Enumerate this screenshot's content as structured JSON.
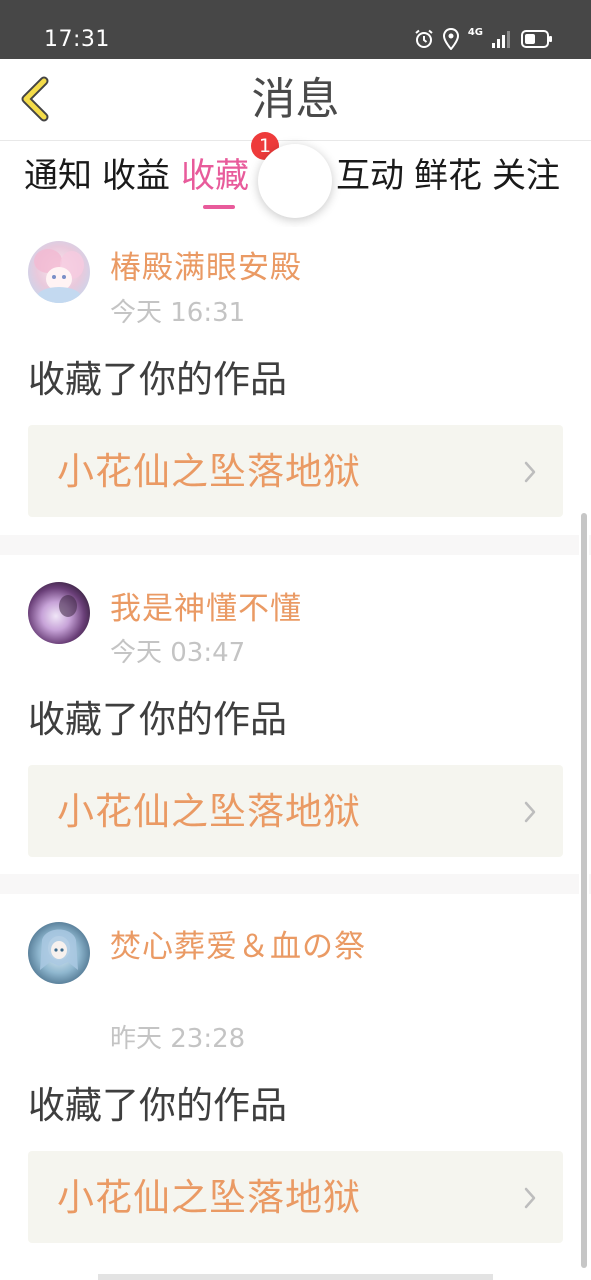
{
  "status_bar": {
    "time": "17:31",
    "network_label": "4G",
    "icons": [
      "alarm-icon",
      "location-icon",
      "signal-icon",
      "battery-icon"
    ]
  },
  "header": {
    "back_icon": "chevron-left-icon",
    "title": "消息"
  },
  "tabs": {
    "items": [
      {
        "label": "通知"
      },
      {
        "label": "收益"
      },
      {
        "label": "收藏"
      },
      {
        "label": "互动"
      },
      {
        "label": "鲜花"
      },
      {
        "label": "关注"
      }
    ],
    "active_index": 2,
    "badge_count": "1"
  },
  "colors": {
    "accent": "#e85b9b",
    "username": "#ea9a64",
    "status_bar": "#474747",
    "badge": "#ee3b3b",
    "card_box": "#f5f5ef"
  },
  "feed": [
    {
      "username": "椿殿满眼安殿",
      "time": "今天 16:31",
      "action": "收藏了你的作品",
      "work_title": "小花仙之坠落地狱"
    },
    {
      "username": "我是神懂不懂",
      "time": "今天 03:47",
      "action": "收藏了你的作品",
      "work_title": "小花仙之坠落地狱"
    },
    {
      "username": "焚心葬爱＆血の祭",
      "time": "昨天 23:28",
      "action": "收藏了你的作品",
      "work_title": "小花仙之坠落地狱"
    }
  ]
}
